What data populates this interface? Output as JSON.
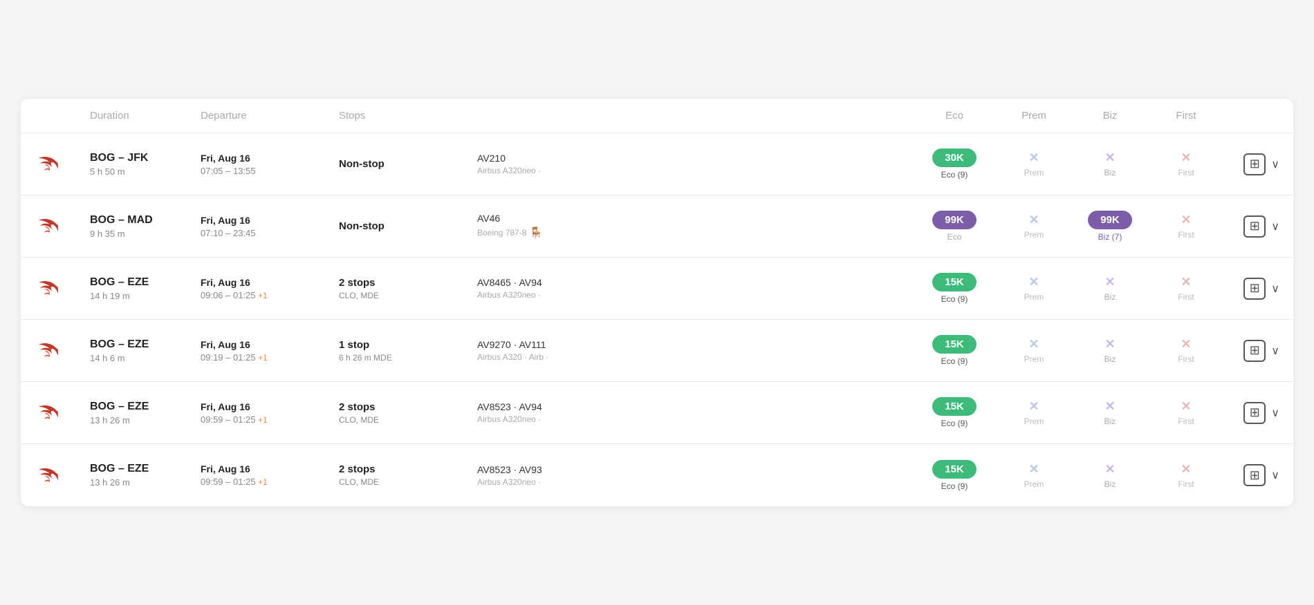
{
  "header": {
    "cols": [
      "",
      "Duration",
      "Departure",
      "Stops",
      "",
      "Eco",
      "Prem",
      "Biz",
      "First",
      ""
    ]
  },
  "flights": [
    {
      "id": 1,
      "route": "BOG – JFK",
      "duration": "5 h 50 m",
      "date": "Fri, Aug 16",
      "time": "07:05 – 13:55",
      "time_plus": "",
      "stops": "Non-stop",
      "stops_detail": "",
      "flight_num": "AV210",
      "aircraft": "Airbus A320neo",
      "seat_icon": false,
      "price": "30K",
      "price_color": "green",
      "eco_label": "Eco (9)",
      "prem_label": "Prem",
      "biz_label": "Biz",
      "first_label": "First"
    },
    {
      "id": 2,
      "route": "BOG – MAD",
      "duration": "9 h 35 m",
      "date": "Fri, Aug 16",
      "time": "07:10 – 23:45",
      "time_plus": "",
      "stops": "Non-stop",
      "stops_detail": "",
      "flight_num": "AV46",
      "aircraft": "Boeing 787-8",
      "seat_icon": true,
      "price": "99K",
      "price_color": "purple",
      "eco_label": "Eco",
      "prem_label": "Prem",
      "biz_label": "Biz (7)",
      "first_label": "First"
    },
    {
      "id": 3,
      "route": "BOG – EZE",
      "duration": "14 h 19 m",
      "date": "Fri, Aug 16",
      "time": "09:06 – 01:25",
      "time_plus": "+1",
      "stops": "2 stops",
      "stops_detail": "CLO, MDE",
      "flight_num": "AV8465 · AV94",
      "aircraft": "Airbus A320neo",
      "seat_icon": false,
      "price": "15K",
      "price_color": "green",
      "eco_label": "Eco (9)",
      "prem_label": "Prem",
      "biz_label": "Biz",
      "first_label": "First"
    },
    {
      "id": 4,
      "route": "BOG – EZE",
      "duration": "14 h 6 m",
      "date": "Fri, Aug 16",
      "time": "09:19 – 01:25",
      "time_plus": "+1",
      "stops": "1 stop",
      "stops_detail": "6 h 26 m MDE",
      "flight_num": "AV9270 · AV111",
      "aircraft": "Airbus A320 · Airb",
      "seat_icon": false,
      "price": "15K",
      "price_color": "green",
      "eco_label": "Eco (9)",
      "prem_label": "Prem",
      "biz_label": "Biz",
      "first_label": "First"
    },
    {
      "id": 5,
      "route": "BOG – EZE",
      "duration": "13 h 26 m",
      "date": "Fri, Aug 16",
      "time": "09:59 – 01:25",
      "time_plus": "+1",
      "stops": "2 stops",
      "stops_detail": "CLO, MDE",
      "flight_num": "AV8523 · AV94",
      "aircraft": "Airbus A320neo",
      "seat_icon": false,
      "price": "15K",
      "price_color": "green",
      "eco_label": "Eco (9)",
      "prem_label": "Prem",
      "biz_label": "Biz",
      "first_label": "First"
    },
    {
      "id": 6,
      "route": "BOG – EZE",
      "duration": "13 h 26 m",
      "date": "Fri, Aug 16",
      "time": "09:59 – 01:25",
      "time_plus": "+1",
      "stops": "2 stops",
      "stops_detail": "CLO, MDE",
      "flight_num": "AV8523 · AV93",
      "aircraft": "Airbus A320neo",
      "seat_icon": false,
      "price": "15K",
      "price_color": "green",
      "eco_label": "Eco (9)",
      "prem_label": "Prem",
      "biz_label": "Biz",
      "first_label": "First"
    }
  ],
  "cabin_x": "✕",
  "add_btn_label": "⊞",
  "expand_btn_label": "∨"
}
